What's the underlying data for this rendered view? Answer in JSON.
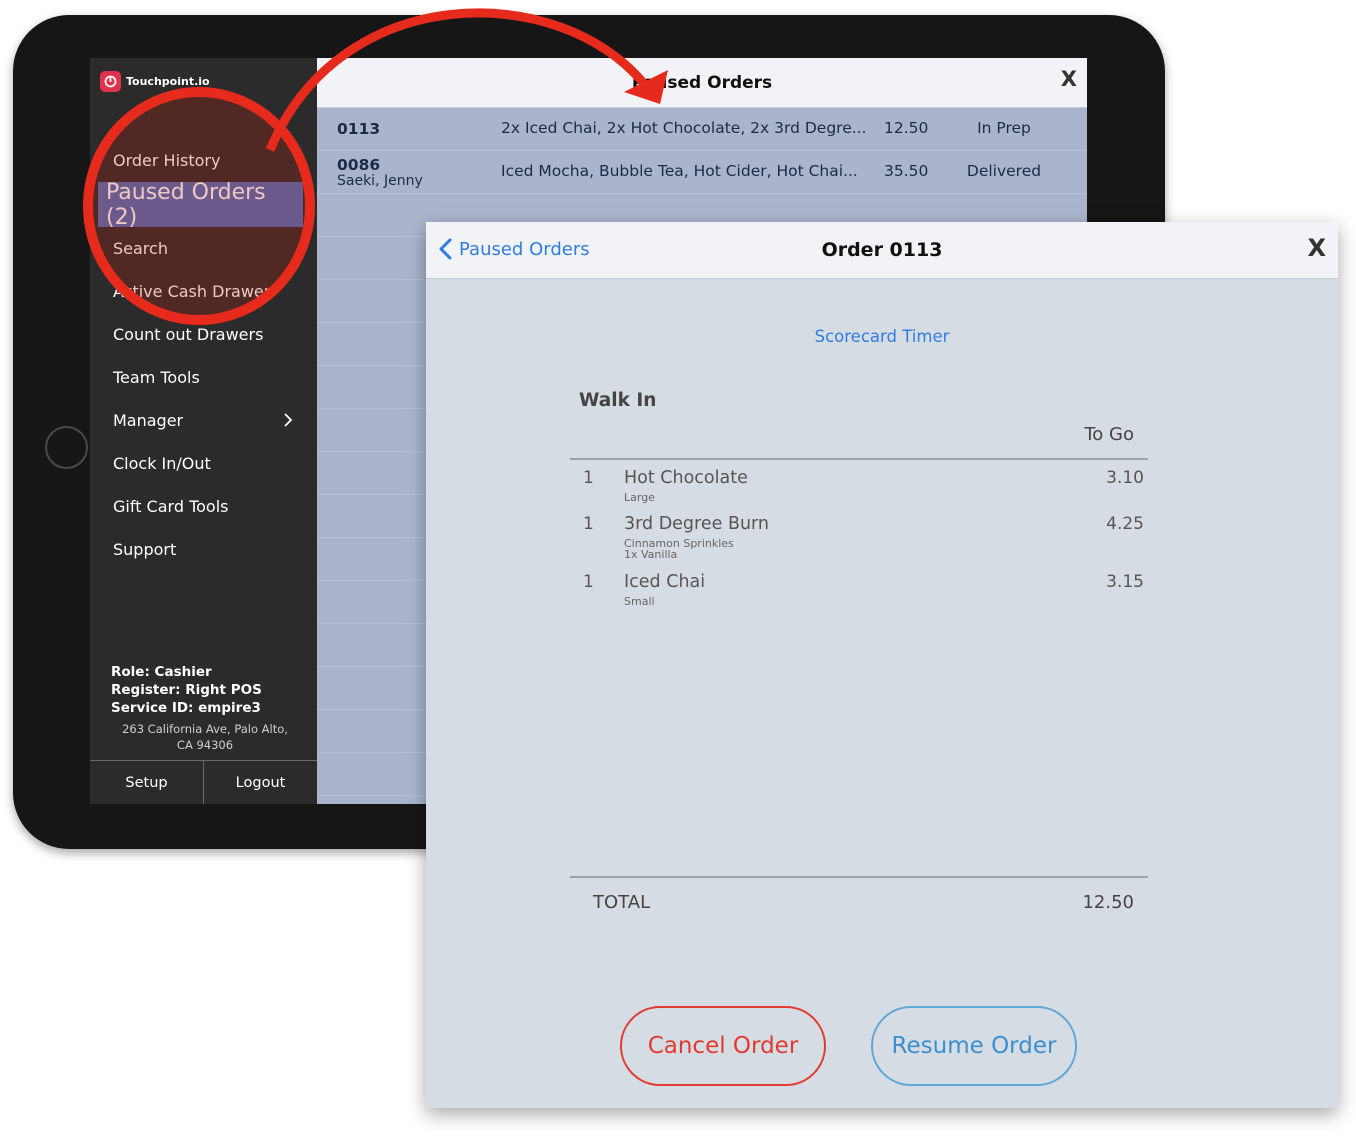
{
  "app": {
    "brand": "Touchpoint.io"
  },
  "sidebar": {
    "items": [
      {
        "label": "Order History"
      },
      {
        "label": "Paused Orders (2)"
      },
      {
        "label": "Search"
      },
      {
        "label": "Active Cash Drawer"
      },
      {
        "label": "Count out Drawers"
      },
      {
        "label": "Team Tools"
      },
      {
        "label": "Manager"
      },
      {
        "label": "Clock In/Out"
      },
      {
        "label": "Gift Card Tools"
      },
      {
        "label": "Support"
      }
    ],
    "role": "Role: Cashier",
    "register": "Register: Right POS",
    "service_id": "Service ID: empire3",
    "address_line1": "263 California Ave, Palo Alto,",
    "address_line2": "CA 94306",
    "setup_label": "Setup",
    "logout_label": "Logout"
  },
  "paused_list": {
    "title": "Paused Orders",
    "close_label": "X",
    "orders": [
      {
        "number": "0113",
        "customer": "",
        "items": "2x Iced Chai, 2x Hot Chocolate, 2x 3rd Degre...",
        "amount": "12.50",
        "status": "In Prep"
      },
      {
        "number": "0086",
        "customer": "Saeki, Jenny",
        "items": "Iced Mocha, Bubble Tea, Hot Cider, Hot Chai...",
        "amount": "35.50",
        "status": "Delivered"
      }
    ]
  },
  "order_detail": {
    "back_label": "Paused Orders",
    "title": "Order 0113",
    "close_label": "X",
    "timer_link": "Scorecard Timer",
    "order_type": "Walk In",
    "service_type": "To Go",
    "line_items": [
      {
        "qty": "1",
        "name": "Hot Chocolate",
        "price": "3.10",
        "modifiers": [
          "Large"
        ]
      },
      {
        "qty": "1",
        "name": "3rd Degree Burn",
        "price": "4.25",
        "modifiers": [
          "Cinnamon Sprinkles",
          "1x Vanilla"
        ]
      },
      {
        "qty": "1",
        "name": "Iced Chai",
        "price": "3.15",
        "modifiers": [
          "Small"
        ]
      }
    ],
    "total_label": "TOTAL",
    "total_value": "12.50",
    "cancel_label": "Cancel Order",
    "resume_label": "Resume Order"
  },
  "colors": {
    "annotation_red": "#e62a1c",
    "accent_blue": "#2f7de0",
    "active_item": "#4d6fb6"
  }
}
